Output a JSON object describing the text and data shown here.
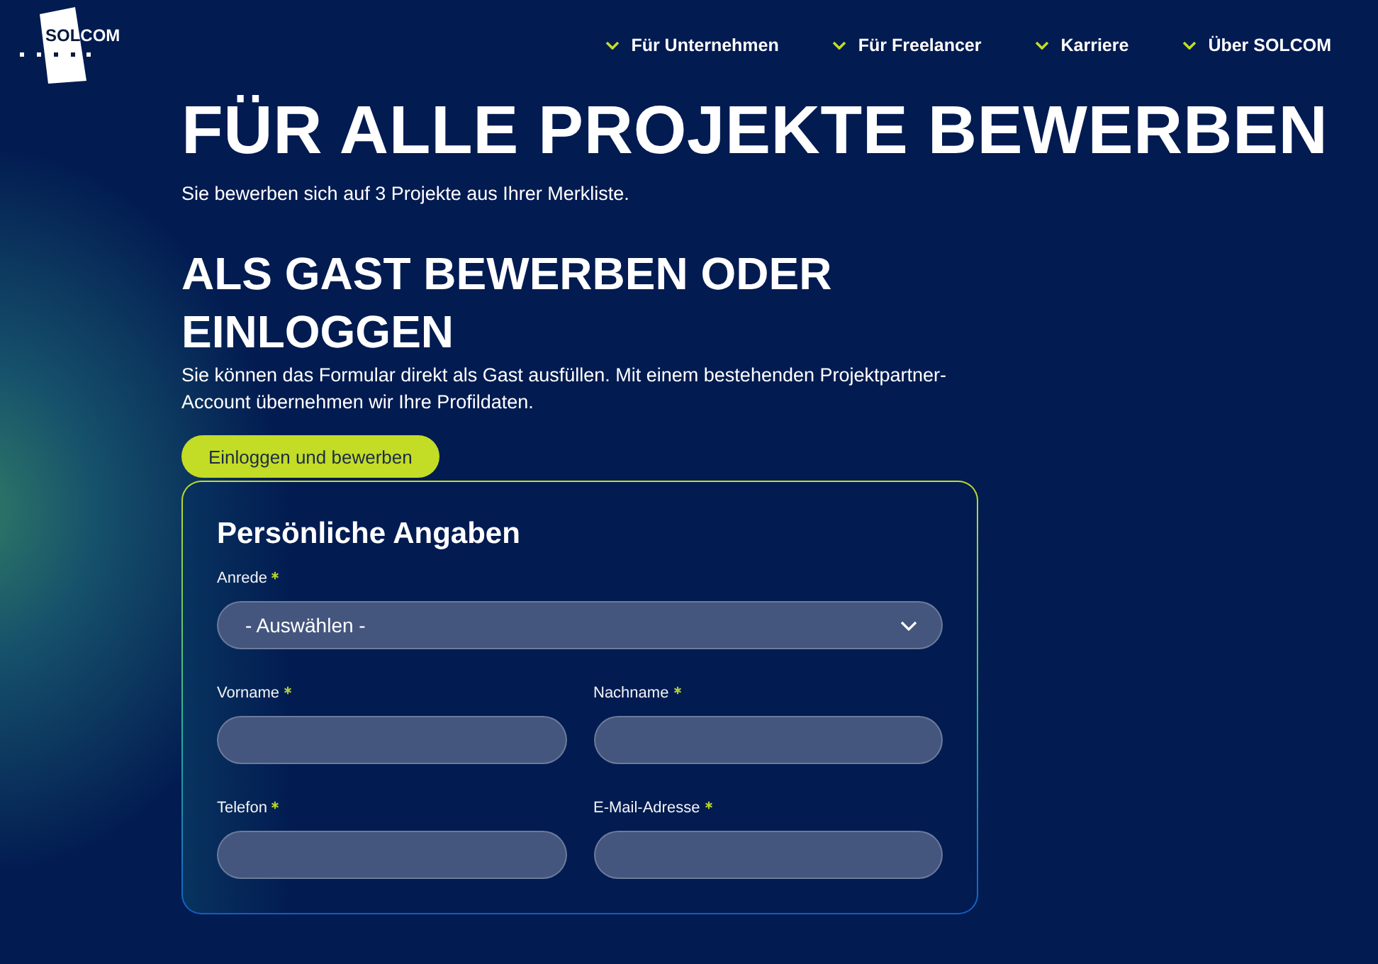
{
  "header": {
    "logo": {
      "text": "SOLCOM"
    },
    "nav": [
      {
        "label": "Für Unternehmen"
      },
      {
        "label": "Für Freelancer"
      },
      {
        "label": "Karriere"
      },
      {
        "label": "Über SOLCOM"
      }
    ]
  },
  "page": {
    "title": "FÜR ALLE PROJEKTE BEWERBEN",
    "subtitle": "Sie bewerben sich auf 3 Projekte aus Ihrer Merkliste.",
    "section_title": "ALS GAST BEWERBEN ODER EINLOGGEN",
    "intro": "Sie können das Formular direkt als Gast ausfüllen. Mit einem bestehenden Projektpartner-Account übernehmen wir Ihre Profildaten.",
    "login_button": "Einloggen und bewerben"
  },
  "form": {
    "title": "Persönliche Angaben",
    "fields": [
      {
        "kind": "select",
        "label": "Anrede",
        "required": true,
        "value": "- Auswählen -"
      },
      {
        "kind": "text",
        "label": "Vorname",
        "required": true
      },
      {
        "kind": "text",
        "label": "Nachname",
        "required": true
      },
      {
        "kind": "text",
        "label": "Telefon",
        "required": true
      },
      {
        "kind": "text",
        "label": "E-Mail-Adresse",
        "required": true
      }
    ]
  }
}
